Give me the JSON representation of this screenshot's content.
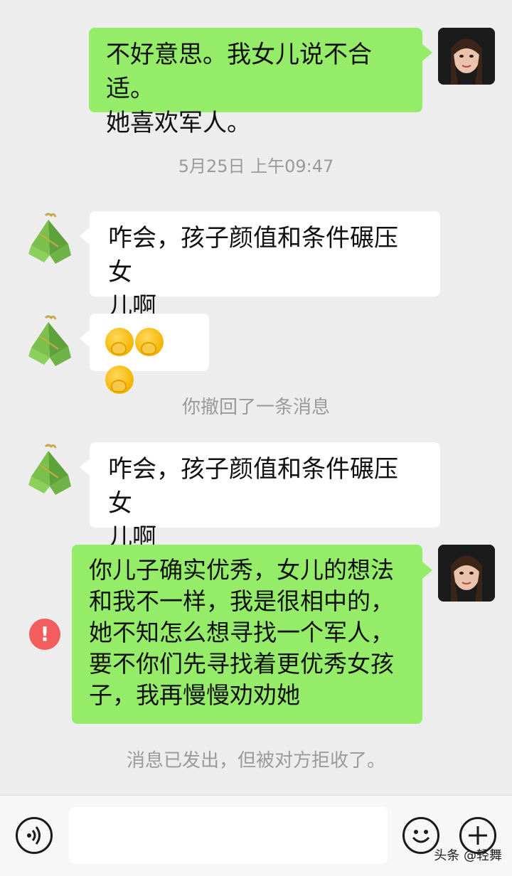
{
  "messages": {
    "m1": {
      "line1": "不好意思。我女儿说不合适。",
      "line2": "她喜欢军人。"
    },
    "timestamp": "5月25日 上午09:47",
    "m2": {
      "line1": "咋会，孩子颜值和条件碾压女",
      "line2": "儿啊"
    },
    "m3": {
      "emoji_name": "shush-face-emoji"
    },
    "recall_notice": "你撤回了一条消息",
    "m4": {
      "line1": "咋会，孩子颜值和条件碾压女",
      "line2": "儿啊"
    },
    "m5": {
      "line1": "你儿子确实优秀，女儿的想法",
      "line2": "和我不一样，我是很相中的，",
      "line3": "她不知怎么想寻找一个军人，",
      "line4": "要不你们先寻找着更优秀女孩",
      "line5": "子，我再慢慢劝劝她"
    },
    "error_symbol": "!",
    "rejected_notice": "消息已发出，但被对方拒收了。"
  },
  "input_bar": {
    "voice_icon": "voice-icon",
    "emoji_icon": "emoji-icon",
    "plus_icon": "plus-icon",
    "placeholder": ""
  },
  "watermark": "头条 @轻舞",
  "colors": {
    "background": "#ededed",
    "sent_bubble": "#95ec69",
    "received_bubble": "#ffffff",
    "error_red": "#f25d5d",
    "meta_text": "#9a9a9a"
  }
}
